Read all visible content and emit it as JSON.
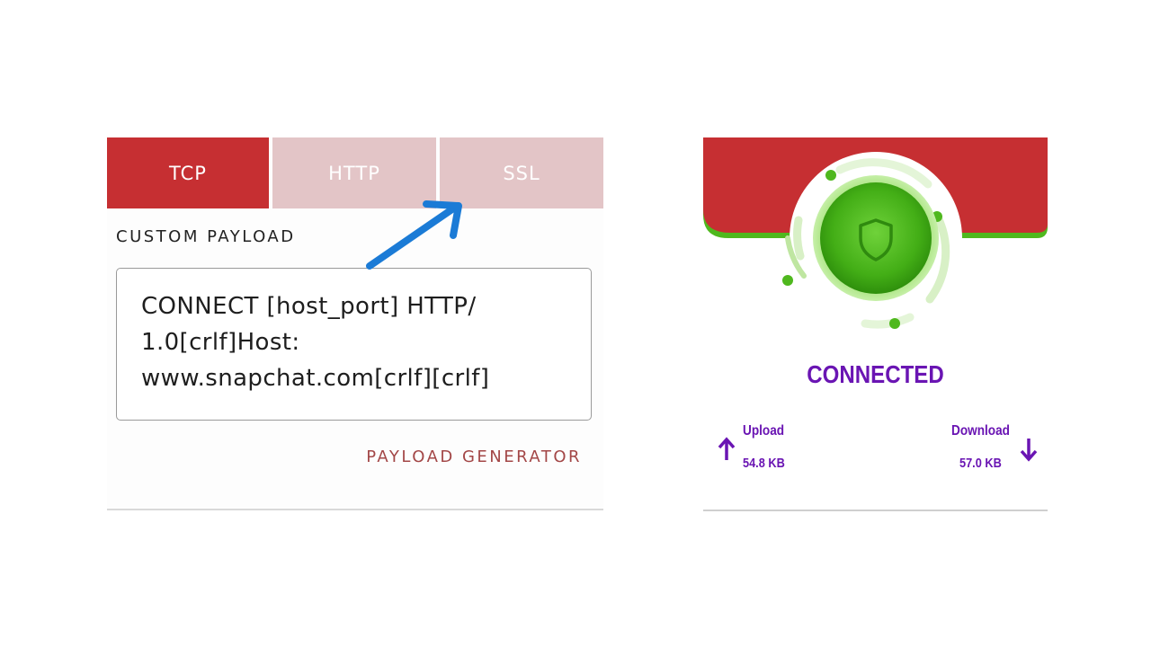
{
  "colors": {
    "accent": "#c62f32",
    "tab_inactive": "#e3c5c7",
    "green": "#4fb81e",
    "purple": "#6a15b3",
    "link": "#a34747",
    "arrow_blue": "#1b7bd6"
  },
  "tabs": [
    {
      "label": "TCP",
      "active": true
    },
    {
      "label": "HTTP",
      "active": false
    },
    {
      "label": "SSL",
      "active": false
    }
  ],
  "payload": {
    "section_label": "CUSTOM PAYLOAD",
    "value": "CONNECT [host_port] HTTP/\n1.0[crlf]Host:\nwww.snapchat.com[crlf][crlf]",
    "generator_label": "PAYLOAD GENERATOR"
  },
  "connection": {
    "icon": "shield-icon",
    "status": "CONNECTED",
    "upload": {
      "label": "Upload",
      "value": "54.8 KB",
      "icon": "arrow-up-icon"
    },
    "download": {
      "label": "Download",
      "value": "57.0 KB",
      "icon": "arrow-down-icon"
    }
  }
}
